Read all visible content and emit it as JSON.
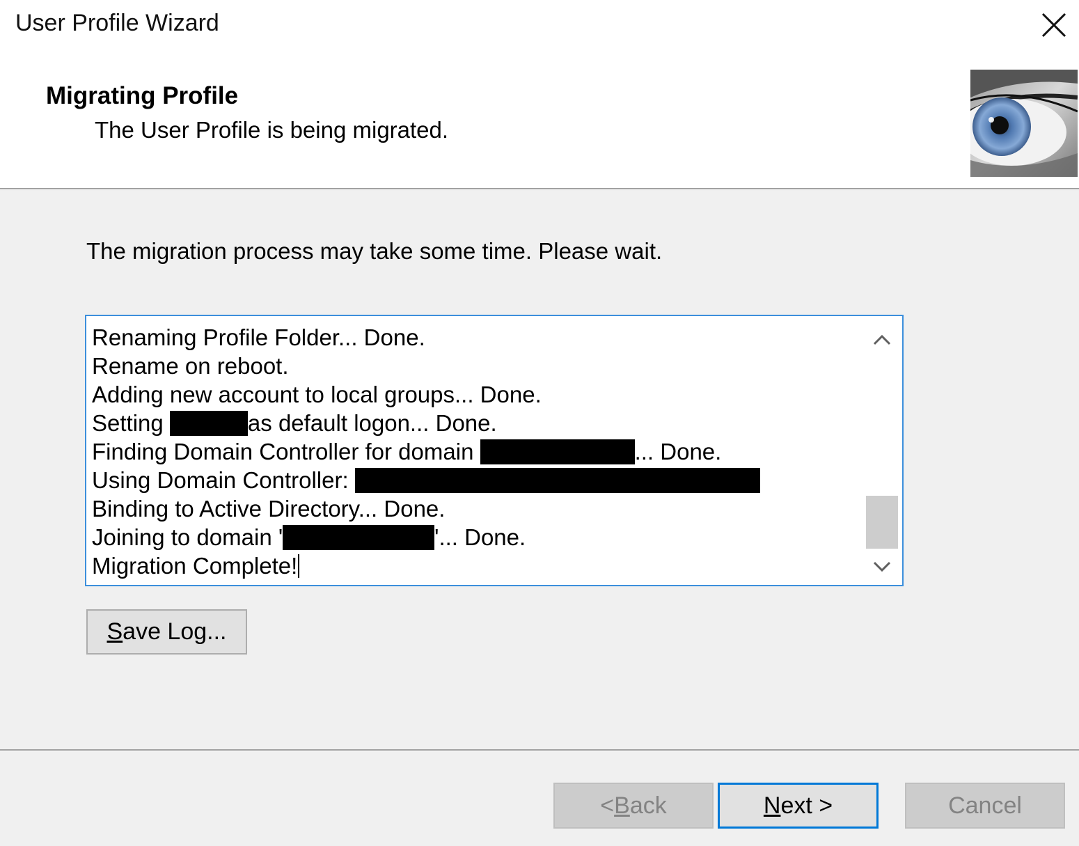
{
  "window": {
    "title": "User Profile Wizard",
    "close_icon": "close-icon"
  },
  "header": {
    "title": "Migrating Profile",
    "subtitle": "The User Profile is being migrated.",
    "image": "eye-image"
  },
  "body": {
    "instruction": "The migration process may take some time. Please wait."
  },
  "log": {
    "lines": [
      {
        "before": "Renaming Profile Folder... Done.",
        "redacted": false,
        "after": ""
      },
      {
        "before": "Rename on reboot.",
        "redacted": false,
        "after": ""
      },
      {
        "before": "Adding new account to local groups... Done.",
        "redacted": false,
        "after": ""
      },
      {
        "before": "Setting ",
        "redacted": true,
        "after": "as default logon... Done."
      },
      {
        "before": "Finding Domain Controller for domain ",
        "redacted": true,
        "after": "... Done."
      },
      {
        "before": "Using Domain Controller:  ",
        "redacted": true,
        "after": ""
      },
      {
        "before": "Binding to Active Directory... Done.",
        "redacted": false,
        "after": ""
      },
      {
        "before": "Joining to domain '",
        "redacted": true,
        "after": "'... Done."
      },
      {
        "before": "Migration Complete!",
        "redacted": false,
        "after": ""
      }
    ],
    "scroll_up_icon": "chevron-up-icon",
    "scroll_down_icon": "chevron-down-icon"
  },
  "buttons": {
    "save_log": {
      "accel": "S",
      "rest": "ave Log..."
    },
    "back": {
      "prefix": "< ",
      "accel": "B",
      "rest": "ack"
    },
    "next": {
      "accel": "N",
      "rest": "ext >"
    },
    "cancel": "Cancel"
  }
}
